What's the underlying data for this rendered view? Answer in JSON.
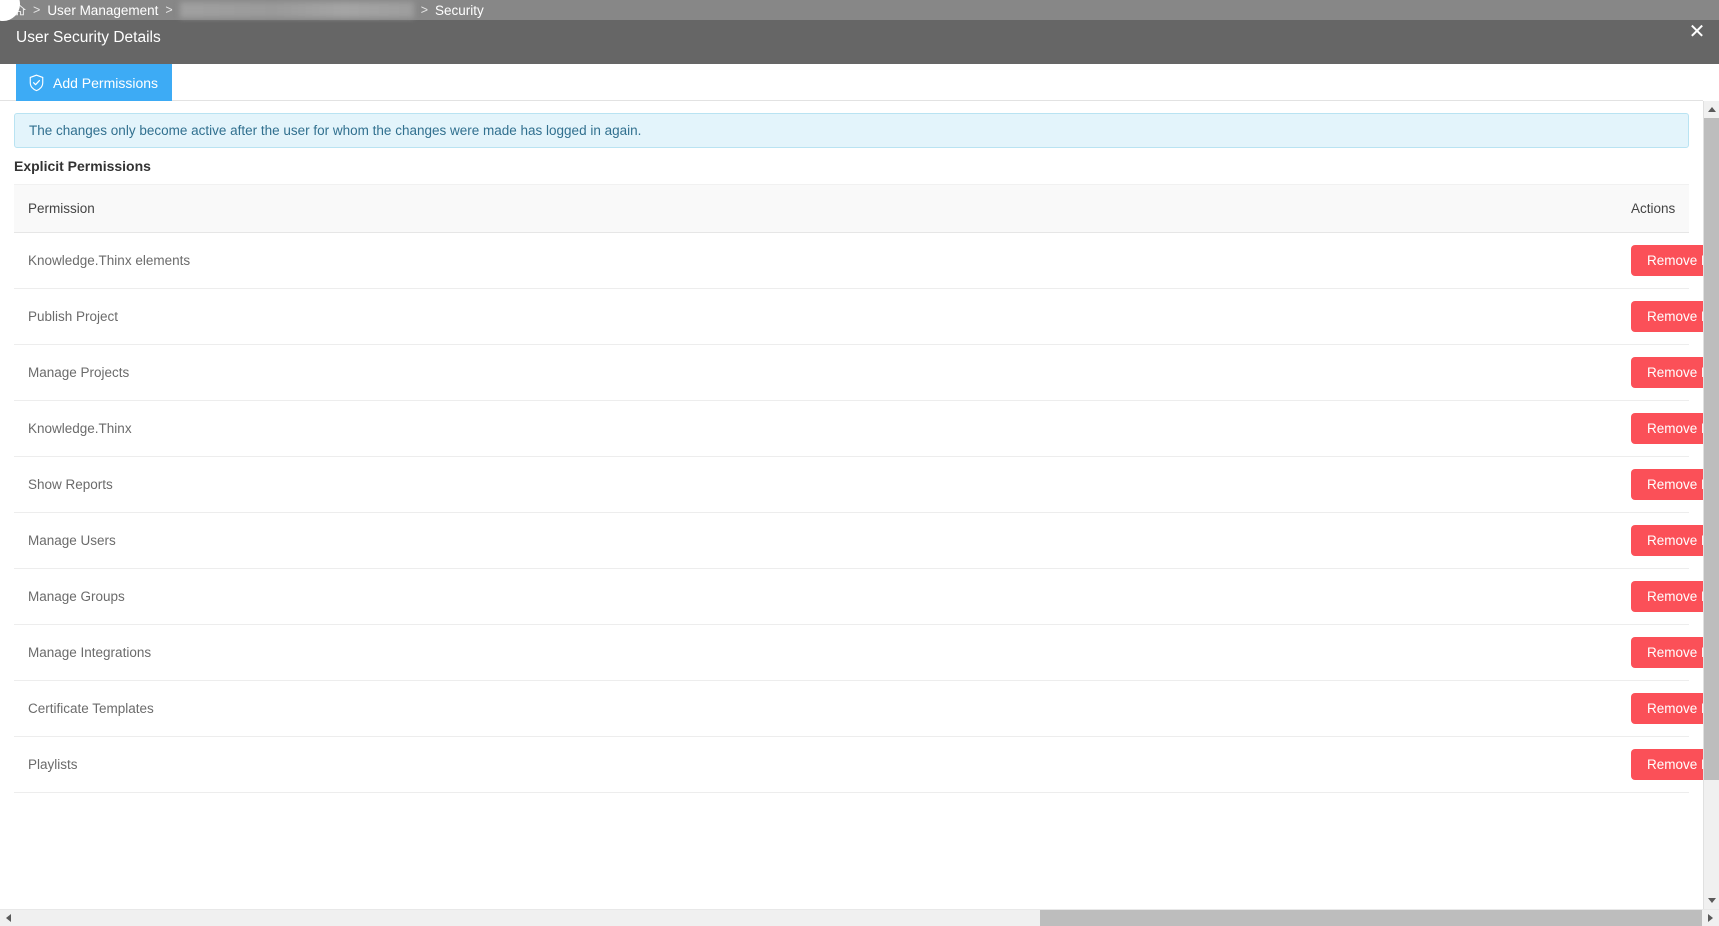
{
  "header": {
    "breadcrumb": {
      "home_icon": "home-icon",
      "separator": ">",
      "items": [
        {
          "label": "User Management",
          "redacted": false
        },
        {
          "label": "",
          "redacted": true
        },
        {
          "label": "Security",
          "redacted": false
        }
      ]
    },
    "page_title": "User Security Details",
    "close_label": "✕",
    "band_color": "#666666",
    "band_top_color": "#878787"
  },
  "tabs": [
    {
      "label": "Add Permissions",
      "icon": "shield-check-icon",
      "active": true,
      "color": "#3dabf5"
    }
  ],
  "alert": {
    "message": "The changes only become active after the user for whom the changes were made has logged in again.",
    "background": "#e3f4fb",
    "border": "#b9e3f2"
  },
  "section": {
    "title": "Explicit Permissions"
  },
  "table": {
    "columns": [
      "Permission",
      "Actions"
    ],
    "action_button_label": "Remove Permission",
    "action_button_color": "#fb5058",
    "rows": [
      {
        "permission": "Knowledge.Thinx elements"
      },
      {
        "permission": "Publish Project"
      },
      {
        "permission": "Manage Projects"
      },
      {
        "permission": "Knowledge.Thinx"
      },
      {
        "permission": "Show Reports"
      },
      {
        "permission": "Manage Users"
      },
      {
        "permission": "Manage Groups"
      },
      {
        "permission": "Manage Integrations"
      },
      {
        "permission": "Certificate Templates"
      },
      {
        "permission": "Playlists"
      }
    ]
  },
  "scrollbars": {
    "vertical": {
      "up_icon": "triangle-up-icon",
      "down_icon": "triangle-down-icon"
    },
    "horizontal": {
      "left_icon": "triangle-left-icon",
      "right_icon": "triangle-right-icon"
    }
  }
}
